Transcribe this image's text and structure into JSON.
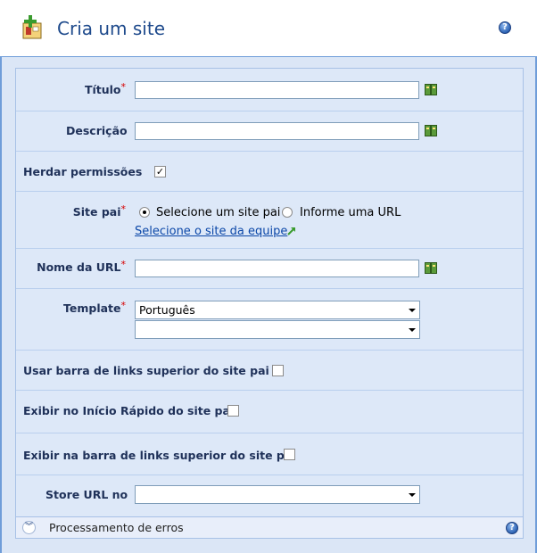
{
  "header": {
    "title": "Cria um site",
    "logo_icon": "add-site-icon",
    "help_icon": "help-icon"
  },
  "form": {
    "titulo": {
      "label": "Título",
      "value": ""
    },
    "descricao": {
      "label": "Descrição",
      "value": ""
    },
    "herdar": {
      "label": "Herdar permissões",
      "checked": true
    },
    "site_pai": {
      "label": "Site pai",
      "option1": "Selecione um site pai",
      "option2": "Informe uma URL",
      "selected": "option1",
      "link": "Selecione o site da equipe"
    },
    "nome_url": {
      "label": "Nome da URL",
      "value": ""
    },
    "template": {
      "label": "Template",
      "value1": "Português",
      "value2": ""
    },
    "usar_barra": {
      "label": "Usar barra de links superior do site pai",
      "checked": false
    },
    "exibir_inicio": {
      "label": "Exibir no Início Rápido do site pai",
      "checked": false
    },
    "exibir_barra": {
      "label": "Exibir na barra de links superior do site pai",
      "checked": false
    },
    "store_url": {
      "label": "Store URL no",
      "value": ""
    }
  },
  "error_section": {
    "label": "Processamento de erros",
    "expand_icon": "chevron-down-icon"
  },
  "colors": {
    "title": "#1e4a8c",
    "border": "#6f9dd9",
    "panel_bg": "#dde8f8",
    "required": "#d60000",
    "link": "#0b47a8"
  }
}
